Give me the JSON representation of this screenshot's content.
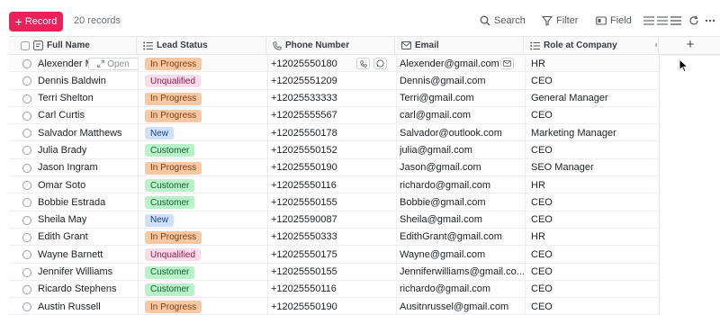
{
  "toolbar": {
    "record_label": "Record",
    "record_count": "20 records",
    "search_label": "Search",
    "filter_label": "Filter",
    "field_label": "Field",
    "accent_color": "#e8235a"
  },
  "columns": {
    "full_name": "Full Name",
    "lead_status": "Lead Status",
    "phone_number": "Phone Number",
    "email": "Email",
    "role": "Role at Company",
    "add_column": "+"
  },
  "open_label": "Open",
  "status_colors": {
    "In Progress": "#f9c8a3",
    "Unqualified": "#fadbe8",
    "New": "#cfe0fb",
    "Customer": "#b9f2c9"
  },
  "rows": [
    {
      "name": "Alexender Martin",
      "status": "In Progress",
      "phone": "+12025550180",
      "email": "Alexender@gmail.com",
      "role": "HR"
    },
    {
      "name": "Dennis Baldwin",
      "status": "Unqualified",
      "phone": "+12025551209",
      "email": "Dennis@gmail.com",
      "role": "CEO"
    },
    {
      "name": "Terri Shelton",
      "status": "In Progress",
      "phone": "+12025533333",
      "email": "Terri@gmail.com",
      "role": "General Manager"
    },
    {
      "name": "Carl Curtis",
      "status": "In Progress",
      "phone": "+12025555567",
      "email": "carl@gmail.com",
      "role": "CEO"
    },
    {
      "name": "Salvador Matthews",
      "status": "New",
      "phone": "+12025550178",
      "email": "Salvador@outlook.com",
      "role": "Marketing Manager"
    },
    {
      "name": "Julia Brady",
      "status": "Customer",
      "phone": "+12025550152",
      "email": "julia@gmail.com",
      "role": "CEO"
    },
    {
      "name": "Jason Ingram",
      "status": "In Progress",
      "phone": "+12025550190",
      "email": "Jason@gmail.com",
      "role": "SEO Manager"
    },
    {
      "name": "Omar Soto",
      "status": "Customer",
      "phone": "+12025550116",
      "email": "richardo@gmail.com",
      "role": "HR"
    },
    {
      "name": "Bobbie Estrada",
      "status": "Customer",
      "phone": "+12025550155",
      "email": "Bobbie@gmail.com",
      "role": "CEO"
    },
    {
      "name": "Sheila May",
      "status": "New",
      "phone": "+12025590087",
      "email": "Sheila@gmail.com",
      "role": "CEO"
    },
    {
      "name": "Edith Grant",
      "status": "In Progress",
      "phone": "+12025550333",
      "email": "EdithGrant@gmail.com",
      "role": "HR"
    },
    {
      "name": "Wayne Barnett",
      "status": "Unqualified",
      "phone": "+12025550175",
      "email": "Wayne@gmail.com",
      "role": "CEO"
    },
    {
      "name": "Jennifer Williams",
      "status": "Customer",
      "phone": "+12025550155",
      "email": "Jenniferwilliams@gmail.co...",
      "role": "CEO"
    },
    {
      "name": "Ricardo Stephens",
      "status": "Customer",
      "phone": "+12025550116",
      "email": "richardo@gmail.com",
      "role": "CEO"
    },
    {
      "name": "Austin Russell",
      "status": "In Progress",
      "phone": "+12025550190",
      "email": "Ausitnrussel@gmail.com",
      "role": "CEO"
    }
  ]
}
